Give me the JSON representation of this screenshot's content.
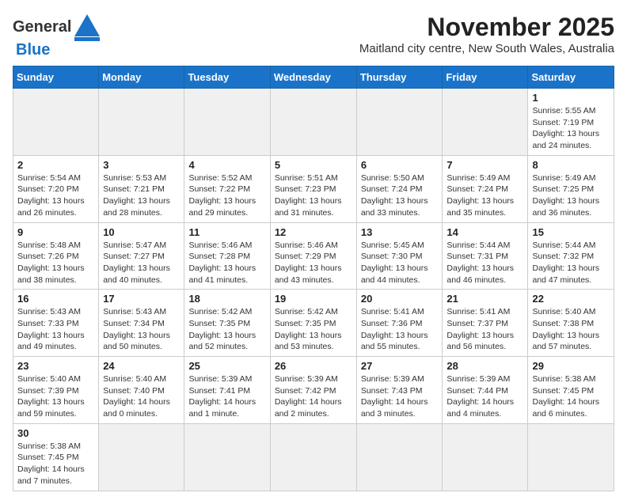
{
  "header": {
    "month_title": "November 2025",
    "location": "Maitland city centre, New South Wales, Australia",
    "logo_general": "General",
    "logo_blue": "Blue"
  },
  "weekdays": [
    "Sunday",
    "Monday",
    "Tuesday",
    "Wednesday",
    "Thursday",
    "Friday",
    "Saturday"
  ],
  "days": [
    {
      "num": "",
      "sunrise": "",
      "sunset": "",
      "daylight": ""
    },
    {
      "num": "",
      "sunrise": "",
      "sunset": "",
      "daylight": ""
    },
    {
      "num": "",
      "sunrise": "",
      "sunset": "",
      "daylight": ""
    },
    {
      "num": "",
      "sunrise": "",
      "sunset": "",
      "daylight": ""
    },
    {
      "num": "",
      "sunrise": "",
      "sunset": "",
      "daylight": ""
    },
    {
      "num": "",
      "sunrise": "",
      "sunset": "",
      "daylight": ""
    },
    {
      "num": "1",
      "sunrise": "Sunrise: 5:55 AM",
      "sunset": "Sunset: 7:19 PM",
      "daylight": "Daylight: 13 hours and 24 minutes."
    },
    {
      "num": "2",
      "sunrise": "Sunrise: 5:54 AM",
      "sunset": "Sunset: 7:20 PM",
      "daylight": "Daylight: 13 hours and 26 minutes."
    },
    {
      "num": "3",
      "sunrise": "Sunrise: 5:53 AM",
      "sunset": "Sunset: 7:21 PM",
      "daylight": "Daylight: 13 hours and 28 minutes."
    },
    {
      "num": "4",
      "sunrise": "Sunrise: 5:52 AM",
      "sunset": "Sunset: 7:22 PM",
      "daylight": "Daylight: 13 hours and 29 minutes."
    },
    {
      "num": "5",
      "sunrise": "Sunrise: 5:51 AM",
      "sunset": "Sunset: 7:23 PM",
      "daylight": "Daylight: 13 hours and 31 minutes."
    },
    {
      "num": "6",
      "sunrise": "Sunrise: 5:50 AM",
      "sunset": "Sunset: 7:24 PM",
      "daylight": "Daylight: 13 hours and 33 minutes."
    },
    {
      "num": "7",
      "sunrise": "Sunrise: 5:49 AM",
      "sunset": "Sunset: 7:24 PM",
      "daylight": "Daylight: 13 hours and 35 minutes."
    },
    {
      "num": "8",
      "sunrise": "Sunrise: 5:49 AM",
      "sunset": "Sunset: 7:25 PM",
      "daylight": "Daylight: 13 hours and 36 minutes."
    },
    {
      "num": "9",
      "sunrise": "Sunrise: 5:48 AM",
      "sunset": "Sunset: 7:26 PM",
      "daylight": "Daylight: 13 hours and 38 minutes."
    },
    {
      "num": "10",
      "sunrise": "Sunrise: 5:47 AM",
      "sunset": "Sunset: 7:27 PM",
      "daylight": "Daylight: 13 hours and 40 minutes."
    },
    {
      "num": "11",
      "sunrise": "Sunrise: 5:46 AM",
      "sunset": "Sunset: 7:28 PM",
      "daylight": "Daylight: 13 hours and 41 minutes."
    },
    {
      "num": "12",
      "sunrise": "Sunrise: 5:46 AM",
      "sunset": "Sunset: 7:29 PM",
      "daylight": "Daylight: 13 hours and 43 minutes."
    },
    {
      "num": "13",
      "sunrise": "Sunrise: 5:45 AM",
      "sunset": "Sunset: 7:30 PM",
      "daylight": "Daylight: 13 hours and 44 minutes."
    },
    {
      "num": "14",
      "sunrise": "Sunrise: 5:44 AM",
      "sunset": "Sunset: 7:31 PM",
      "daylight": "Daylight: 13 hours and 46 minutes."
    },
    {
      "num": "15",
      "sunrise": "Sunrise: 5:44 AM",
      "sunset": "Sunset: 7:32 PM",
      "daylight": "Daylight: 13 hours and 47 minutes."
    },
    {
      "num": "16",
      "sunrise": "Sunrise: 5:43 AM",
      "sunset": "Sunset: 7:33 PM",
      "daylight": "Daylight: 13 hours and 49 minutes."
    },
    {
      "num": "17",
      "sunrise": "Sunrise: 5:43 AM",
      "sunset": "Sunset: 7:34 PM",
      "daylight": "Daylight: 13 hours and 50 minutes."
    },
    {
      "num": "18",
      "sunrise": "Sunrise: 5:42 AM",
      "sunset": "Sunset: 7:35 PM",
      "daylight": "Daylight: 13 hours and 52 minutes."
    },
    {
      "num": "19",
      "sunrise": "Sunrise: 5:42 AM",
      "sunset": "Sunset: 7:35 PM",
      "daylight": "Daylight: 13 hours and 53 minutes."
    },
    {
      "num": "20",
      "sunrise": "Sunrise: 5:41 AM",
      "sunset": "Sunset: 7:36 PM",
      "daylight": "Daylight: 13 hours and 55 minutes."
    },
    {
      "num": "21",
      "sunrise": "Sunrise: 5:41 AM",
      "sunset": "Sunset: 7:37 PM",
      "daylight": "Daylight: 13 hours and 56 minutes."
    },
    {
      "num": "22",
      "sunrise": "Sunrise: 5:40 AM",
      "sunset": "Sunset: 7:38 PM",
      "daylight": "Daylight: 13 hours and 57 minutes."
    },
    {
      "num": "23",
      "sunrise": "Sunrise: 5:40 AM",
      "sunset": "Sunset: 7:39 PM",
      "daylight": "Daylight: 13 hours and 59 minutes."
    },
    {
      "num": "24",
      "sunrise": "Sunrise: 5:40 AM",
      "sunset": "Sunset: 7:40 PM",
      "daylight": "Daylight: 14 hours and 0 minutes."
    },
    {
      "num": "25",
      "sunrise": "Sunrise: 5:39 AM",
      "sunset": "Sunset: 7:41 PM",
      "daylight": "Daylight: 14 hours and 1 minute."
    },
    {
      "num": "26",
      "sunrise": "Sunrise: 5:39 AM",
      "sunset": "Sunset: 7:42 PM",
      "daylight": "Daylight: 14 hours and 2 minutes."
    },
    {
      "num": "27",
      "sunrise": "Sunrise: 5:39 AM",
      "sunset": "Sunset: 7:43 PM",
      "daylight": "Daylight: 14 hours and 3 minutes."
    },
    {
      "num": "28",
      "sunrise": "Sunrise: 5:39 AM",
      "sunset": "Sunset: 7:44 PM",
      "daylight": "Daylight: 14 hours and 4 minutes."
    },
    {
      "num": "29",
      "sunrise": "Sunrise: 5:38 AM",
      "sunset": "Sunset: 7:45 PM",
      "daylight": "Daylight: 14 hours and 6 minutes."
    },
    {
      "num": "30",
      "sunrise": "Sunrise: 5:38 AM",
      "sunset": "Sunset: 7:45 PM",
      "daylight": "Daylight: 14 hours and 7 minutes."
    },
    {
      "num": "",
      "sunrise": "",
      "sunset": "",
      "daylight": ""
    },
    {
      "num": "",
      "sunrise": "",
      "sunset": "",
      "daylight": ""
    },
    {
      "num": "",
      "sunrise": "",
      "sunset": "",
      "daylight": ""
    },
    {
      "num": "",
      "sunrise": "",
      "sunset": "",
      "daylight": ""
    },
    {
      "num": "",
      "sunrise": "",
      "sunset": "",
      "daylight": ""
    },
    {
      "num": "",
      "sunrise": "",
      "sunset": "",
      "daylight": ""
    }
  ]
}
